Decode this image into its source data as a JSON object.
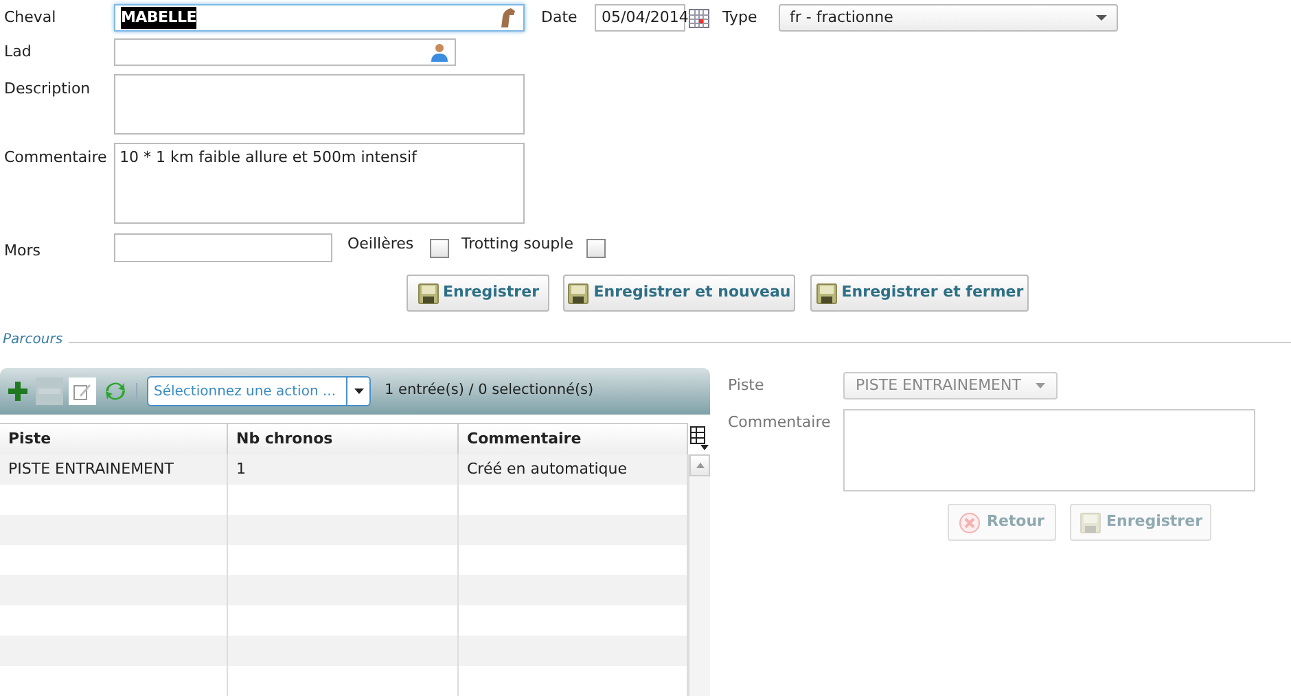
{
  "form": {
    "cheval": {
      "label": "Cheval",
      "value": "MABELLE",
      "text_selected": true,
      "focused": true
    },
    "date": {
      "label": "Date",
      "value": "05/04/2014"
    },
    "type": {
      "label": "Type",
      "value": "fr - fractionne"
    },
    "lad": {
      "label": "Lad"
    },
    "description": {
      "label": "Description"
    },
    "commentaire": {
      "label": "Commentaire",
      "value": "10 * 1 km faible allure et 500m intensif"
    },
    "mors": {
      "label": "Mors"
    },
    "checkboxes": [
      {
        "label": "Oeillères",
        "checked": false
      },
      {
        "label": "Trotting souple",
        "checked": false
      }
    ],
    "buttons": [
      {
        "label": "Enregistrer"
      },
      {
        "label": "Enregistrer et nouveau"
      },
      {
        "label": "Enregistrer et fermer"
      }
    ]
  },
  "parcours": {
    "title": "Parcours",
    "toolbar": {
      "buttons": [
        {
          "kind": "add",
          "disabled": false
        },
        {
          "kind": "remove",
          "disabled": true
        },
        {
          "kind": "edit",
          "disabled": false
        },
        {
          "kind": "refresh",
          "disabled": false
        }
      ],
      "action_placeholder": "Sélectionnez une action ...",
      "count": "1 entrée(s) / 0 selectionné(s)"
    },
    "grid": {
      "columns": [
        "Piste",
        "Nb chronos",
        "Commentaire"
      ],
      "rows": [
        [
          "PISTE ENTRAINEMENT",
          "1",
          "Créé en automatique"
        ]
      ]
    },
    "detail": {
      "piste": {
        "label": "Piste",
        "value": "PISTE ENTRAINEMENT",
        "disabled": true
      },
      "commentaire": {
        "label": "Commentaire"
      },
      "buttons": [
        {
          "kind": "back",
          "label": "Retour",
          "disabled": true
        },
        {
          "kind": "save",
          "label": "Enregistrer",
          "disabled": true
        }
      ]
    }
  }
}
